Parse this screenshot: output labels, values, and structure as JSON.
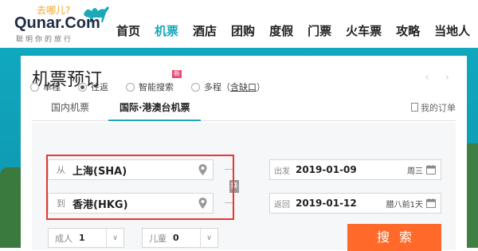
{
  "logo": {
    "tagline": "去哪儿?",
    "brand": "Qunar.Com",
    "slogan": "聪明你的旅行"
  },
  "nav": {
    "items": [
      {
        "label": "首页",
        "active": false
      },
      {
        "label": "机票",
        "active": true
      },
      {
        "label": "酒店",
        "active": false
      },
      {
        "label": "团购",
        "active": false
      },
      {
        "label": "度假",
        "active": false
      },
      {
        "label": "门票",
        "active": false
      },
      {
        "label": "火车票",
        "active": false
      },
      {
        "label": "攻略",
        "active": false
      },
      {
        "label": "当地人",
        "active": false
      }
    ]
  },
  "card": {
    "title": "机票预订",
    "pager": "‹ ›",
    "tabs": {
      "domestic": "国内机票",
      "international": "国际·港澳台机票"
    },
    "my_orders": "我的订单"
  },
  "trip_types": {
    "one_way": "单程",
    "round_trip": "往返",
    "smart_search": "智能搜索",
    "new_badge": "新",
    "multi_city_prefix": "多程（",
    "multi_city_link": "含缺口",
    "multi_city_suffix": "）",
    "selected": "round_trip"
  },
  "route": {
    "from_label": "从",
    "from_value": "上海(SHA)",
    "to_label": "到",
    "to_value": "香港(HKG)",
    "swap_label": "换"
  },
  "dates": {
    "depart_label": "出发",
    "depart_value": "2019-01-09",
    "depart_dow": "周三",
    "return_label": "返回",
    "return_value": "2019-01-12",
    "return_dow": "腊八前1天"
  },
  "passengers": {
    "adult_label": "成人",
    "adult_value": "1",
    "child_label": "儿童",
    "child_value": "0"
  },
  "search_button": "搜索",
  "colors": {
    "accent": "#1ba9ba",
    "banner": "#10a8bf",
    "search": "#ff6a2b",
    "highlight": "#e53935"
  }
}
